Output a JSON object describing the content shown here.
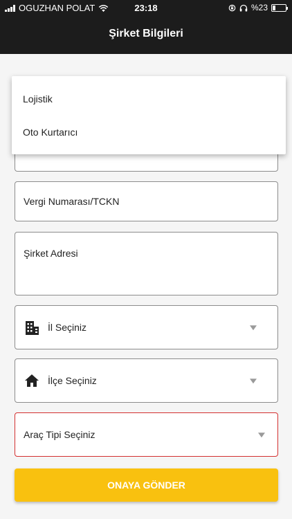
{
  "status_bar": {
    "carrier": "OGUZHAN POLAT",
    "time": "23:18",
    "battery": "%23",
    "battery_level": 0.23
  },
  "header": {
    "title": "Şirket Bilgileri"
  },
  "form": {
    "tax_number_placeholder": "Vergi Numarası/TCKN",
    "address_placeholder": "Şirket Adresi",
    "city_select": "İl Seçiniz",
    "district_select": "İlçe Seçiniz",
    "vehicle_type_select": "Araç Tipi Seçiniz",
    "submit_label": "ONAYA GÖNDER"
  },
  "dropdown": {
    "options": [
      "Lojistik",
      "Oto Kurtarıcı"
    ]
  },
  "colors": {
    "header_bg": "#1c1c1c",
    "accent": "#f9c10f",
    "error_border": "#d32f2f"
  },
  "icons": {
    "city": "building-icon",
    "district": "home-icon",
    "select": "caret-down-icon"
  }
}
